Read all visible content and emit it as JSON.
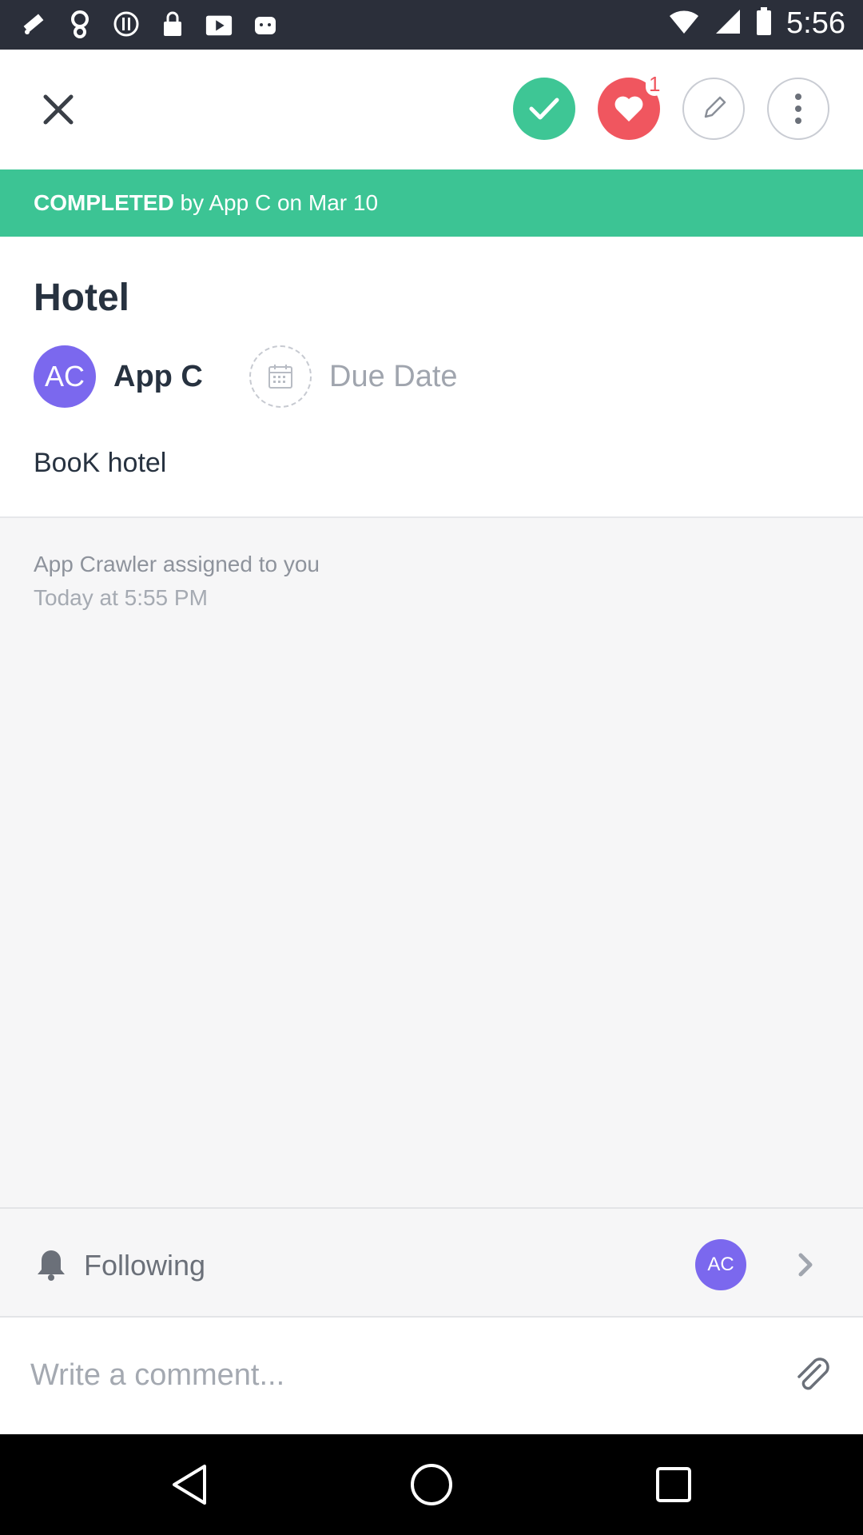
{
  "status_bar": {
    "time": "5:56",
    "icons": [
      "fake-gps-icon",
      "location-pin-icon",
      "data-saver-icon",
      "lock-icon",
      "play-store-icon",
      "android-icon",
      "wifi-icon",
      "signal-icon",
      "battery-icon"
    ]
  },
  "toolbar": {
    "close_icon": "close-icon",
    "complete_icon": "check-icon",
    "like_icon": "heart-icon",
    "like_count": "1",
    "edit_icon": "pencil-icon",
    "more_icon": "more-vertical-icon"
  },
  "banner": {
    "status": "COMPLETED",
    "detail": " by App C on Mar 10",
    "color": "#3cc494"
  },
  "task": {
    "title": "Hotel",
    "assignee_initials": "AC",
    "assignee_name": "App C",
    "due_date_label": "Due Date",
    "description": "BooK hotel"
  },
  "activity": {
    "text": "App Crawler assigned to you",
    "time": "Today at 5:55 PM"
  },
  "followers": {
    "label": "Following",
    "avatar_initials": "AC"
  },
  "comment": {
    "placeholder": "Write a comment..."
  },
  "colors": {
    "accent": "#3ec695",
    "like": "#f0565f",
    "avatar": "#7b68ee"
  }
}
